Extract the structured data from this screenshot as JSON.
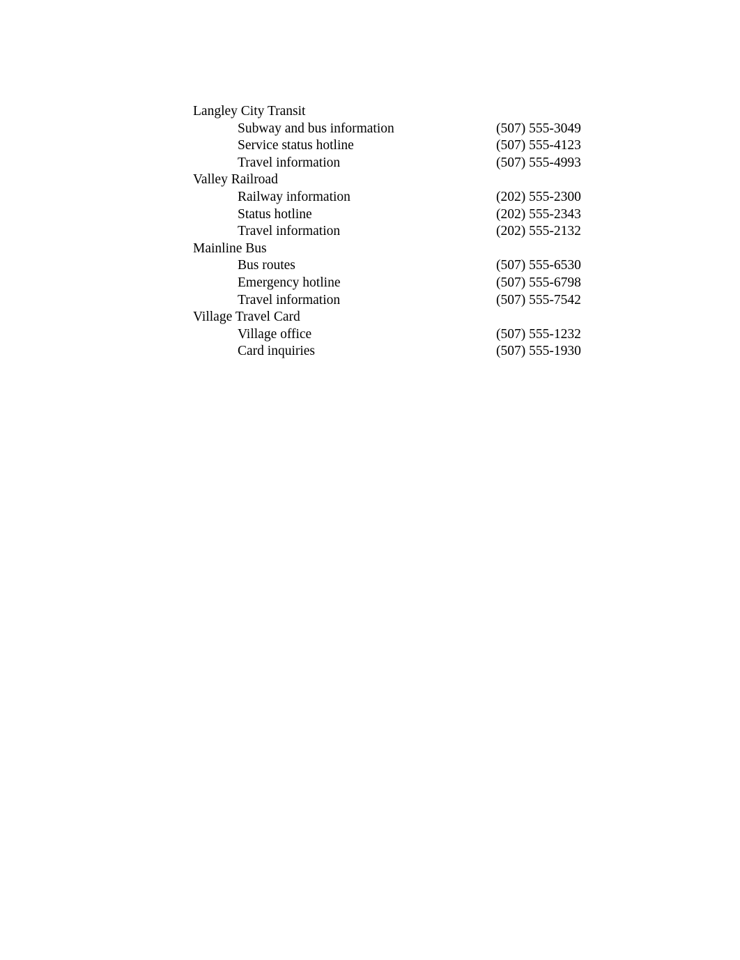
{
  "document": {
    "sections": [
      {
        "heading": "Langley City Transit",
        "entries": [
          {
            "label": "Subway and bus information",
            "phone": "(507) 555-3049"
          },
          {
            "label": "Service status hotline",
            "phone": "(507) 555-4123"
          },
          {
            "label": "Travel information",
            "phone": "(507) 555-4993"
          }
        ]
      },
      {
        "heading": "Valley Railroad",
        "entries": [
          {
            "label": "Railway information",
            "phone": "(202) 555-2300"
          },
          {
            "label": "Status hotline",
            "phone": "(202) 555-2343"
          },
          {
            "label": "Travel information",
            "phone": "(202) 555-2132"
          }
        ]
      },
      {
        "heading": "Mainline Bus",
        "entries": [
          {
            "label": "Bus routes",
            "phone": "(507) 555-6530"
          },
          {
            "label": "Emergency hotline",
            "phone": "(507) 555-6798"
          },
          {
            "label": "Travel information",
            "phone": "(507) 555-7542"
          }
        ]
      },
      {
        "heading": "Village Travel Card",
        "entries": [
          {
            "label": "Village office",
            "phone": "(507) 555-1232"
          },
          {
            "label": "Card inquiries",
            "phone": "(507) 555-1930"
          }
        ]
      }
    ]
  }
}
